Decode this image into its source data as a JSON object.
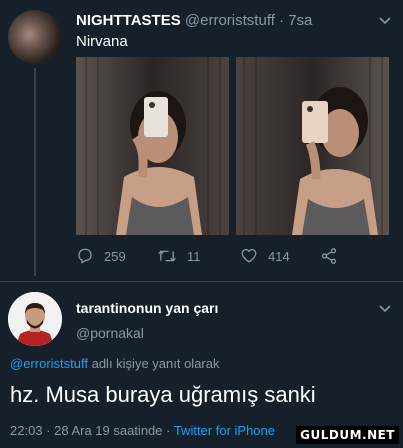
{
  "tweet": {
    "display_name": "NIGHTTASTES",
    "handle_time": "@erroriststuff · 7sa",
    "text": "Nirvana",
    "actions": {
      "reply_count": "259",
      "retweet_count": "11",
      "like_count": "414"
    },
    "icons": {
      "more": "chevron-down-icon",
      "reply": "reply-icon",
      "retweet": "retweet-icon",
      "like": "heart-icon",
      "share": "share-icon"
    }
  },
  "reply": {
    "display_name": "tarantinonun yan çarı",
    "handle": "@pornakal",
    "replying_handle": "@erroriststuff",
    "replying_suffix": " adlı kişiye yanıt olarak",
    "text": "hz. Musa buraya uğramış sanki",
    "timestamp": "22:03 · 28 Ara 19 saatinde · ",
    "client": "Twitter for iPhone"
  },
  "watermark": "GULDUM.NET",
  "colors": {
    "background": "#15202b",
    "secondary_text": "#8899a6",
    "link": "#1da1f2",
    "divider": "#38444d"
  }
}
